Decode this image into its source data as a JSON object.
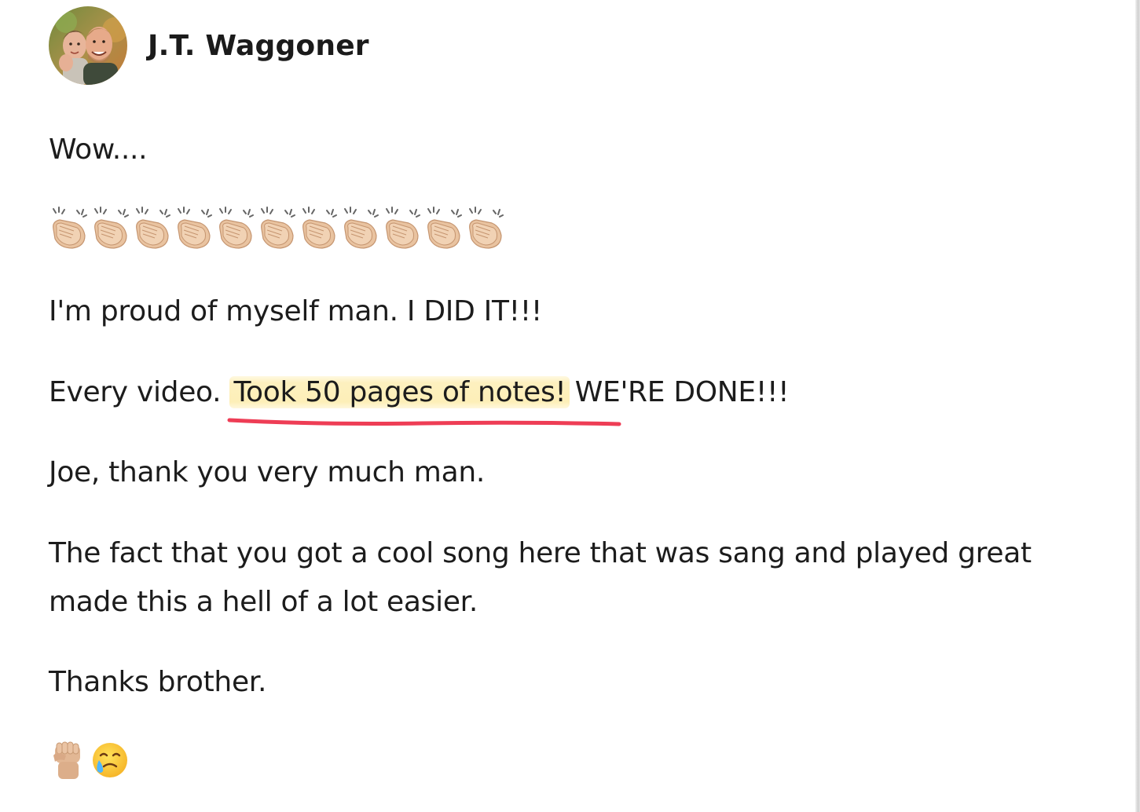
{
  "post": {
    "author": "J.T. Waggoner",
    "avatar_icon": "profile-photo",
    "lines": {
      "wow": "Wow....",
      "proud": "I'm proud of myself man. I DID IT!!!",
      "every_video_before": "Every video. ",
      "every_video_highlight": "Took 50 pages of notes!",
      "every_video_after": " WE'RE DONE!!!",
      "thanks_joe": "Joe, thank you very much man.",
      "fact": "The fact that you got a cool song here that was sang and played great made this a hell of a lot easier.",
      "thanks_brother": "Thanks brother."
    },
    "clap_emoji_count": 11,
    "clap_icon": "clapping-hands-icon",
    "final_emojis": [
      "raised-fist-icon",
      "smiling-face-with-tear-icon"
    ]
  },
  "colors": {
    "highlight": "#fdefb8",
    "underline": "#ee3d55",
    "text": "#1c1c1c"
  }
}
